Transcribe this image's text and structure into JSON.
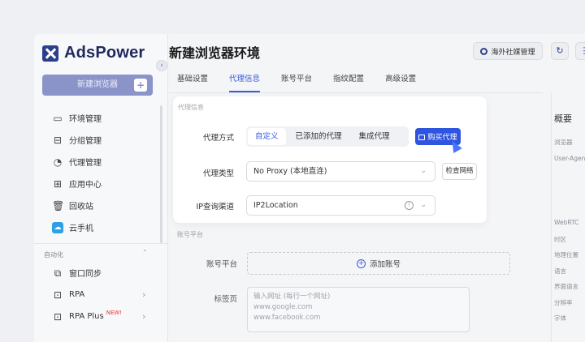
{
  "app": {
    "name": "AdsPower",
    "collapse_icon": "‹"
  },
  "sidebar": {
    "new_button": "新建浏览器",
    "new_plus": "+",
    "items": [
      {
        "label": "环境管理",
        "icon": "window-icon"
      },
      {
        "label": "分组管理",
        "icon": "folder-icon"
      },
      {
        "label": "代理管理",
        "icon": "proxy-icon"
      },
      {
        "label": "应用中心",
        "icon": "apps-icon"
      },
      {
        "label": "回收站",
        "icon": "trash-icon"
      },
      {
        "label": "云手机",
        "icon": "cloud-phone-icon"
      }
    ],
    "automation_label": "自动化",
    "automation_items": [
      {
        "label": "窗口同步",
        "icon": "sync-icon"
      },
      {
        "label": "RPA",
        "icon": "rpa-icon"
      },
      {
        "label": "RPA Plus",
        "icon": "rpa-plus-icon",
        "badge": "NEW!"
      }
    ]
  },
  "header": {
    "title": "新建浏览器环境",
    "social_button": "海外社媒管理"
  },
  "tabs": [
    "基础设置",
    "代理信息",
    "账号平台",
    "指纹配置",
    "高级设置"
  ],
  "active_tab": "代理信息",
  "proxy": {
    "section_label": "代理信息",
    "method_label": "代理方式",
    "methods": [
      "自定义",
      "已添加的代理",
      "集成代理"
    ],
    "active_method": "自定义",
    "buy_button": "购买代理",
    "type_label": "代理类型",
    "type_value": "No Proxy (本地直连)",
    "check_button": "检查网络",
    "ip_label": "IP查询渠道",
    "ip_value": "IP2Location"
  },
  "account": {
    "section_label": "账号平台",
    "platform_label": "账号平台",
    "add_account": "添加账号",
    "tabs_label": "标签页",
    "tabs_placeholder_lines": [
      "输入网址 (每行一个网址)",
      "www.google.com",
      "www.facebook.com"
    ]
  },
  "summary": {
    "title": "概要",
    "items": [
      "浏览器",
      "User-Agent",
      "WebRTC",
      "时区",
      "地理位置",
      "语言",
      "界面语言",
      "分辨率",
      "字体"
    ]
  },
  "colors": {
    "accent": "#3b5bdb",
    "buy": "#2f55e0",
    "brand": "#2d3f8c"
  }
}
